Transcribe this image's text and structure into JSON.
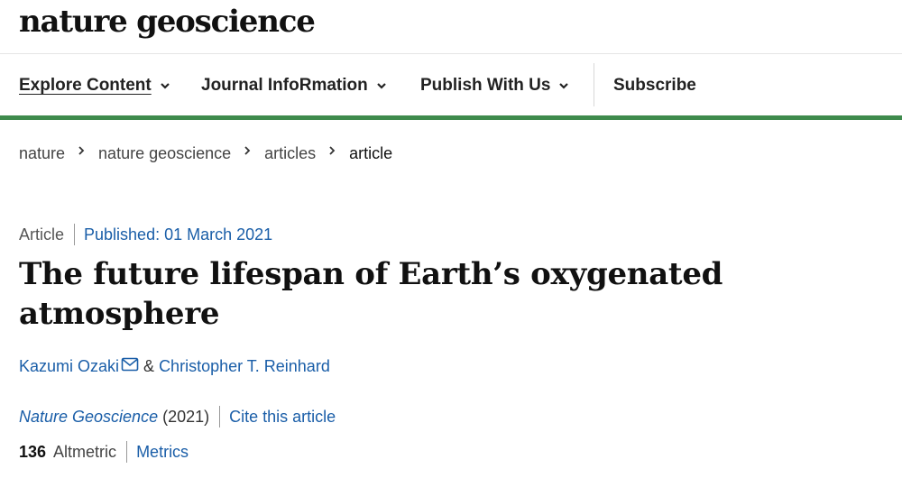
{
  "site": {
    "logo": "nature geoscience"
  },
  "nav": {
    "items": [
      {
        "label": "Explore Content",
        "has_dropdown": true,
        "active": true
      },
      {
        "label": "Journal InfoRmation",
        "has_dropdown": true
      },
      {
        "label": "Publish With Us",
        "has_dropdown": true
      },
      {
        "label": "Subscribe",
        "has_dropdown": false
      }
    ],
    "accent_color": "#3f8b4d",
    "dropdown_icon": "chevron-down-icon"
  },
  "breadcrumb": {
    "items": [
      "nature",
      "nature geoscience",
      "articles",
      "article"
    ],
    "separator_icon": "chevron-right-icon"
  },
  "article": {
    "type": "Article",
    "published": "Published: 01 March 2021",
    "title": "The future lifespan of Earth’s oxygenated atmosphere",
    "authors": [
      {
        "name": "Kazumi Ozaki",
        "has_email_icon": true
      },
      {
        "name": "Christopher T. Reinhard",
        "has_email_icon": false
      }
    ],
    "author_conjunction": "&",
    "journal_name": "Nature Geoscience",
    "journal_year": "(2021)",
    "cite_label": "Cite this article",
    "altmetric_score": "136",
    "altmetric_label": "Altmetric",
    "metrics_label": "Metrics",
    "link_color": "#1a5ea8"
  }
}
